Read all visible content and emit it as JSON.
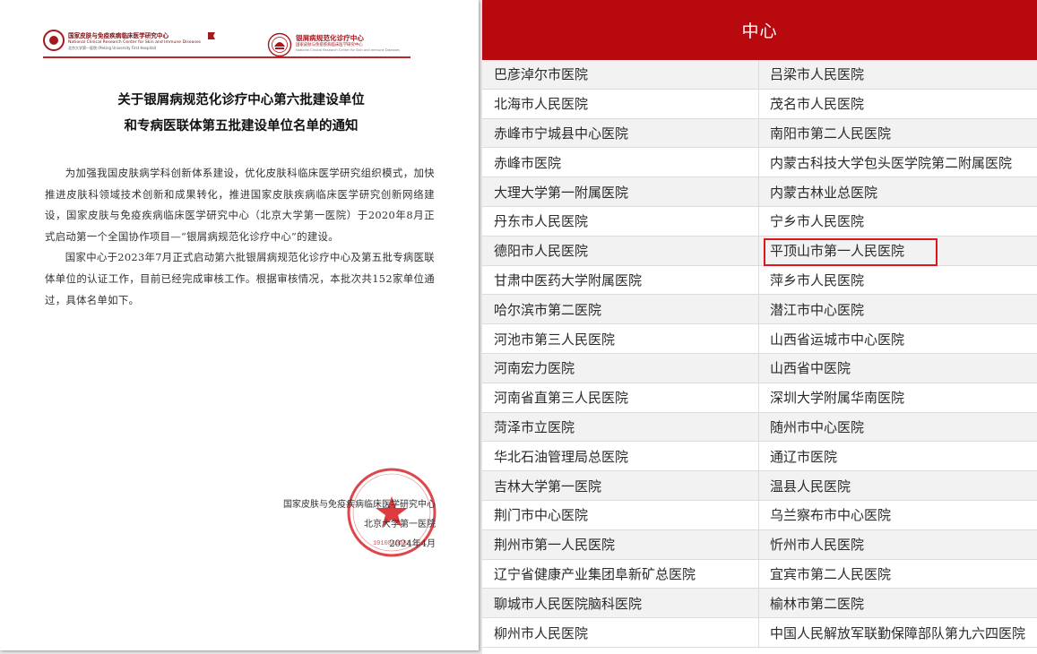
{
  "document": {
    "logo_left": {
      "name_cn": "国家皮肤与免疫疾病临床医学研究中心",
      "name_en": "National Clinical Research Center for Skin and Immune Diseases",
      "affiliation": "北京大学第一医院 (Peking University First Hospital)"
    },
    "logo_right": {
      "name_cn": "银屑病规范化诊疗中心",
      "subtitle": "国家皮肤与免疫疾病临床医学研究中心",
      "name_en": "National Clinical Research Center for Skin and Immune Diseases"
    },
    "title_line1": "关于银屑病规范化诊疗中心第六批建设单位",
    "title_line2": "和专病医联体第五批建设单位名单的通知",
    "para1": "为加强我国皮肤病学科创新体系建设，优化皮肤科临床医学研究组织模式，加快推进皮肤科领域技术创新和成果转化，推进国家皮肤疾病临床医学研究创新网络建设，国家皮肤与免疫疾病临床医学研究中心（北京大学第一医院）于2020年8月正式启动第一个全国协作项目—“银屑病规范化诊疗中心”的建设。",
    "para2": "国家中心于2023年7月正式启动第六批银屑病规范化诊疗中心及第五批专病医联体单位的认证工作，目前已经完成审核工作。根据审核情况，本批次共152家单位通过，具体名单如下。",
    "sign_org": "国家皮肤与免疫疾病临床医学研究中心",
    "sign_hospital": "北京大学第一医院",
    "sign_date": "2024年4月",
    "stamp_text": "北京大学第一医院"
  },
  "table": {
    "header": "中心",
    "rows": [
      [
        "巴彦淖尔市医院",
        "吕梁市人民医院"
      ],
      [
        "北海市人民医院",
        "茂名市人民医院"
      ],
      [
        "赤峰市宁城县中心医院",
        "南阳市第二人民医院"
      ],
      [
        "赤峰市医院",
        "内蒙古科技大学包头医学院第二附属医院"
      ],
      [
        "大理大学第一附属医院",
        "内蒙古林业总医院"
      ],
      [
        "丹东市人民医院",
        "宁乡市人民医院"
      ],
      [
        "德阳市人民医院",
        "平顶山市第一人民医院"
      ],
      [
        "甘肃中医药大学附属医院",
        "萍乡市人民医院"
      ],
      [
        "哈尔滨市第二医院",
        "潜江市中心医院"
      ],
      [
        "河池市第三人民医院",
        "山西省运城市中心医院"
      ],
      [
        "河南宏力医院",
        "山西省中医院"
      ],
      [
        "河南省直第三人民医院",
        "深圳大学附属华南医院"
      ],
      [
        "菏泽市立医院",
        "随州市中心医院"
      ],
      [
        "华北石油管理局总医院",
        "通辽市医院"
      ],
      [
        "吉林大学第一医院",
        "温县人民医院"
      ],
      [
        "荆门市中心医院",
        "乌兰察布市中心医院"
      ],
      [
        "荆州市第一人民医院",
        "忻州市人民医院"
      ],
      [
        "辽宁省健康产业集团阜新矿总医院",
        "宜宾市第二人民医院"
      ],
      [
        "聊城市人民医院脑科医院",
        "榆林市第二医院"
      ],
      [
        "柳州市人民医院",
        "中国人民解放军联勤保障部队第九六四医院"
      ]
    ],
    "highlighted": "平顶山市第一人民医院",
    "highlight_color": "#e0161d",
    "header_color": "#b8090f"
  }
}
